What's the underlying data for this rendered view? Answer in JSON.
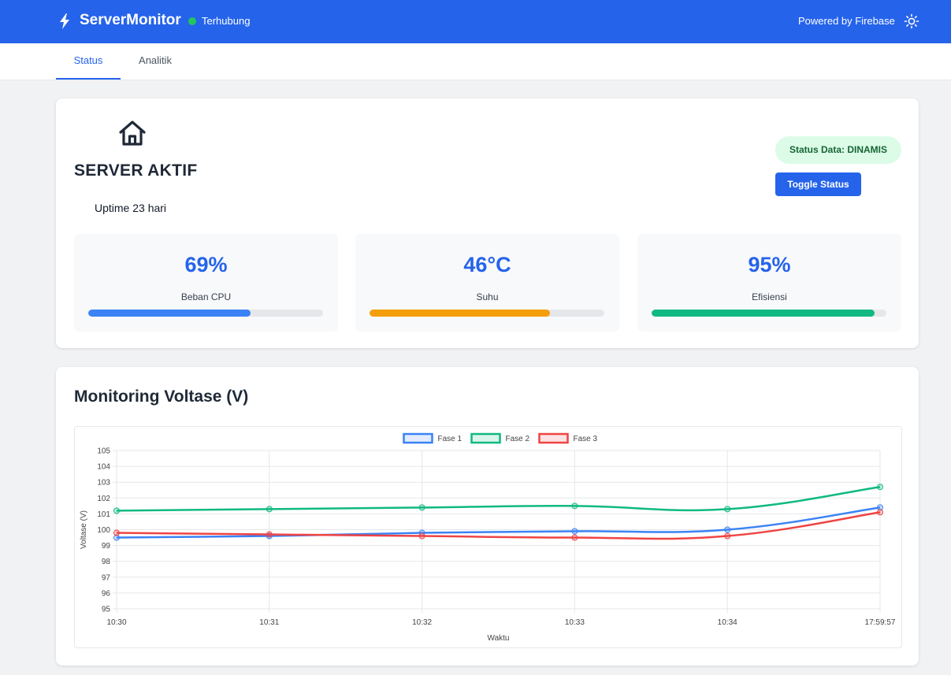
{
  "header": {
    "app_name": "ServerMonitor",
    "connection_status": "Terhubung",
    "powered_by": "Powered by Firebase",
    "bolt_icon": "bolt-icon",
    "theme_icon": "sun-icon",
    "connection_color": "#22c55e",
    "brand_color": "#2563eb"
  },
  "tabs": [
    {
      "label": "Status",
      "active": true
    },
    {
      "label": "Analitik",
      "active": false
    }
  ],
  "server_card": {
    "icon": "home-icon",
    "title": "SERVER AKTIF",
    "uptime": "Uptime 23 hari",
    "status_badge": "Status Data: DINAMIS",
    "toggle_label": "Toggle Status",
    "metrics": [
      {
        "value": "69%",
        "label": "Beban CPU",
        "progress": 0.69,
        "color": "#3b82f6"
      },
      {
        "value": "46°C",
        "label": "Suhu",
        "progress": 0.77,
        "color": "#f59e0b"
      },
      {
        "value": "95%",
        "label": "Efisiensi",
        "progress": 0.95,
        "color": "#10b981"
      }
    ]
  },
  "chart_section": {
    "title": "Monitoring Voltase (V)"
  },
  "chart_data": {
    "type": "line",
    "title": "",
    "xlabel": "Waktu",
    "ylabel": "Voltase (V)",
    "categories": [
      "10:30",
      "10:31",
      "10:32",
      "10:33",
      "10:34",
      "17:59:57"
    ],
    "ylim": [
      95,
      105
    ],
    "yticks": [
      95,
      96,
      97,
      98,
      99,
      100,
      101,
      102,
      103,
      104,
      105
    ],
    "grid": true,
    "legend_position": "top-center",
    "series": [
      {
        "name": "Fase 1",
        "color": "#3b82f6",
        "values": [
          99.5,
          99.6,
          99.8,
          99.9,
          100.0,
          101.4
        ]
      },
      {
        "name": "Fase 2",
        "color": "#10b981",
        "values": [
          101.2,
          101.3,
          101.4,
          101.5,
          101.3,
          102.7
        ]
      },
      {
        "name": "Fase 3",
        "color": "#ef4444",
        "values": [
          99.8,
          99.7,
          99.6,
          99.5,
          99.6,
          101.1
        ]
      }
    ]
  }
}
